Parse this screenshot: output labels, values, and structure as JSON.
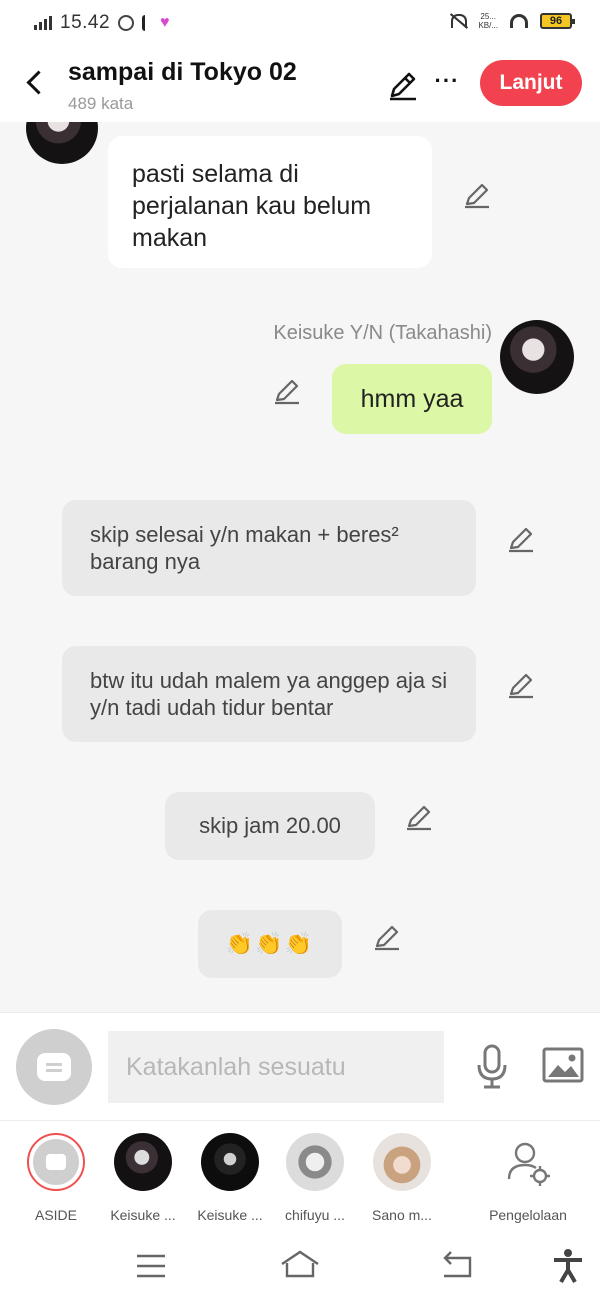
{
  "status_bar": {
    "time": "15.42",
    "net_speed_top": "25...",
    "net_speed_bottom": "KB/...",
    "battery": "96"
  },
  "header": {
    "title": "sampai di Tokyo 02",
    "word_count": "489 kata",
    "continue_label": "Lanjut",
    "more_label": "···"
  },
  "messages": [
    {
      "type": "incoming",
      "text": "pasti selama di perjalanan kau belum makan"
    },
    {
      "type": "outgoing",
      "speaker": "Keisuke Y/N (Takahashi)",
      "text": "hmm yaa"
    },
    {
      "type": "aside",
      "text": "skip selesai y/n makan + beres² barang nya"
    },
    {
      "type": "aside",
      "text": "btw itu udah malem ya anggep aja si y/n tadi udah tidur bentar"
    },
    {
      "type": "aside",
      "text": "skip jam 20.00"
    },
    {
      "type": "aside",
      "text": "👏👏👏"
    }
  ],
  "input": {
    "placeholder": "Katakanlah sesuatu"
  },
  "characters": [
    {
      "label": "ASIDE"
    },
    {
      "label": "Keisuke ..."
    },
    {
      "label": "Keisuke ..."
    },
    {
      "label": "chifuyu ..."
    },
    {
      "label": "Sano m..."
    },
    {
      "label": "Pengelolaan"
    }
  ],
  "colors": {
    "accent": "#f2424f",
    "outgoing_bubble": "#dcf7a5",
    "aside_bubble": "#e9e9e9",
    "background": "#f6f6f6"
  },
  "icons": {
    "back": "chevron-left-icon",
    "edit": "pencil-icon",
    "more": "more-horizontal-icon",
    "mic": "microphone-icon",
    "image": "image-icon",
    "manage": "user-settings-icon"
  }
}
